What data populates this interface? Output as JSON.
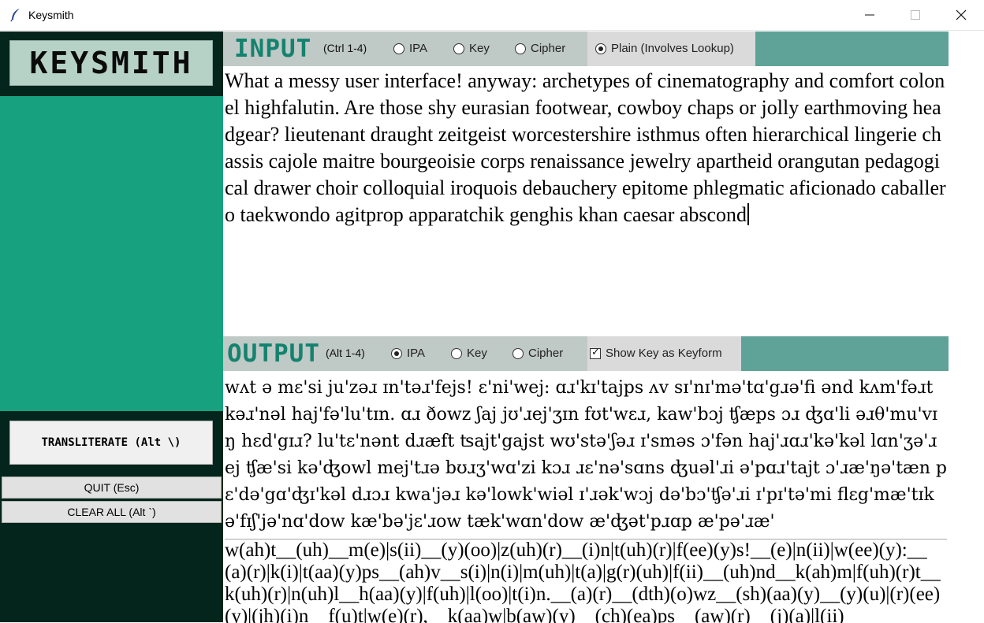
{
  "window": {
    "title": "Keysmith"
  },
  "sidebar": {
    "logo": "KEYSMITH",
    "transliterate_label": "TRANSLITERATE (Alt \\)",
    "quit_label": "QUIT (Esc)",
    "clear_label": "CLEAR ALL (Alt `)"
  },
  "input": {
    "heading": "INPUT",
    "hint": "(Ctrl 1-4)",
    "options": [
      {
        "label": "IPA",
        "selected": false
      },
      {
        "label": "Key",
        "selected": false
      },
      {
        "label": "Cipher",
        "selected": false
      },
      {
        "label": "Plain (Involves Lookup)",
        "selected": true
      }
    ],
    "text": "What a messy user interface! anyway: archetypes of cinematography and comfort colonel highfalutin. Are those shy eurasian footwear, cowboy chaps or jolly earthmoving headgear? lieutenant draught zeitgeist worcestershire isthmus often hierarchical lingerie chassis cajole maitre bourgeoisie corps renaissance jewelry apartheid orangutan pedagogical drawer choir colloquial iroquois debauchery epitome phlegmatic aficionado caballero taekwondo agitprop apparatchik genghis khan caesar abscond"
  },
  "output": {
    "heading": "OUTPUT",
    "hint": "(Alt 1-4)",
    "options": [
      {
        "label": "IPA",
        "selected": true
      },
      {
        "label": "Key",
        "selected": false
      },
      {
        "label": "Cipher",
        "selected": false
      }
    ],
    "show_keyform_label": "Show Key as Keyform",
    "show_keyform_checked": true,
    "ipa_text": "wʌt ə mɛ'si ju'zəɹ ɪn'təɹ'fejs! ɛ'ni'wej: ɑɹ'kɪ'tajps ʌv sɪ'nɪ'mə'tɑ'gɹə'fi ənd kʌm'fəɹt kəɹ'nəl haj'fə'lu'tɪn. ɑɹ ðowz ʃaj jʊ'ɹej'ʒɪn fʊt'wɛɹ, kaw'bɔj ʧæps ɔɹ ʤɑ'li əɹθ'mu'vɪŋ hɛd'gɪɹ? lu'tɛ'nənt dɹæft ʦajt'gajst wʊ'stə'ʃəɹ ɪ'sməs ɔ'fən haj'ɹɑɹ'kə'kəl lɑn'ʒə'ɹej ʧæ'si kə'ʤowl mej'tɹə bʊɹʒ'wɑ'zi kɔɹ ɹɛ'nə'sɑns ʤuəl'ɹi ə'pɑɹ'tajt ɔ'ɹæ'ŋə'tæn pɛ'də'gɑ'ʤɪ'kəl dɹɔɹ kwa'jəɹ kə'lowk'wiəl ɪ'ɹək'wɔj də'bɔ'ʧə'ɹi ɪ'pɪ'tə'mi flɛg'mæ'tɪk ə'fɪʃ'jə'nɑ'dow kæ'bə'jɛ'ɹow tæk'wɑn'dow æ'ʤət'pɹɑp æ'pə'ɹæ'",
    "key_text": "w(ah)t__(uh)__m(e)|s(ii)__(y)(oo)|z(uh)(r)__(i)n|t(uh)(r)|f(ee)(y)s!__(e)|n(ii)|w(ee)(y):__(a)(r)|k(i)|t(aa)(y)ps__(ah)v__s(i)|n(i)|m(uh)|t(a)|g(r)(uh)|f(ii)__(uh)nd__k(ah)m|f(uh)(r)t__k(uh)(r)|n(uh)l__h(aa)(y)|f(uh)|l(oo)|t(i)n.__(a)(r)__(dth)(o)wz__(sh)(aa)(y)__(y)(u)|(r)(ee)(y)|(jh)(i)n__f(u)t|w(e)(r),__k(aa)w|b(aw)(y)__(ch)(ea)ps__(aw)(r)__(j)(a)|l(ii)"
  },
  "colors": {
    "sidebar_green": "#18a17f",
    "dark_green": "#03251b",
    "logo_bg": "#b6d2c6",
    "bar_teal": "#5fa398",
    "heading_teal": "#14826e"
  }
}
